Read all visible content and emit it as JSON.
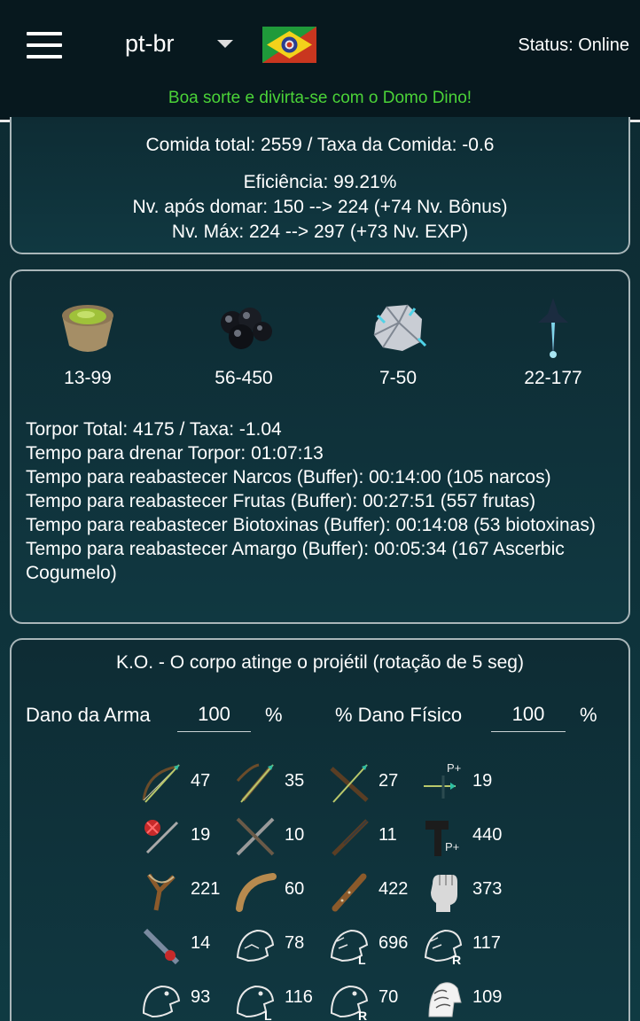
{
  "header": {
    "language": "pt-br",
    "status": "Status: Online",
    "tagline": "Boa sorte e divirta-se com o Domo Dino!"
  },
  "summary": {
    "food_line": "Comida total: 2559 / Taxa da Comida: -0.6",
    "efficiency": "Eficiência: 99.21%",
    "level_after": "Nv. após domar: 150 --> 224 (+74 Nv. Bônus)",
    "level_max": "Nv. Máx: 224 --> 297 (+73 Nv. EXP)"
  },
  "torpor": {
    "items": [
      {
        "icon": "narcotic-bowl-icon",
        "range": "13-99"
      },
      {
        "icon": "narcoberry-icon",
        "range": "56-450"
      },
      {
        "icon": "bio-toxin-icon",
        "range": "7-50"
      },
      {
        "icon": "ascerbic-mushroom-icon",
        "range": "22-177"
      }
    ],
    "lines": [
      "Torpor Total: 4175 / Taxa: -1.04",
      "Tempo para drenar Torpor: 01:07:13",
      "Tempo para reabastecer Narcos (Buffer): 00:14:00 (105 narcos)",
      "Tempo para reabastecer Frutas (Buffer): 00:27:51 (557 frutas)",
      "Tempo para reabastecer Biotoxinas (Buffer): 00:14:08 (53 biotoxinas)",
      "Tempo para reabastecer Amargo (Buffer): 00:05:34 (167 Ascerbic Cogumelo)"
    ]
  },
  "ko": {
    "title": "K.O. - O corpo atinge o projétil (rotação de 5 seg)",
    "weapon_damage_label": "Dano da Arma",
    "weapon_damage_value": "100",
    "weapon_damage_unit": "%",
    "physical_damage_label": "% Dano Físico",
    "physical_damage_value": "100",
    "physical_damage_unit": "%",
    "weapons": [
      {
        "icon": "tranq-arrow-bow-icon",
        "value": "47"
      },
      {
        "icon": "tranq-arrow-crossbow-icon",
        "value": "35"
      },
      {
        "icon": "tranq-arrow-compound-bow-icon",
        "value": "27"
      },
      {
        "icon": "tranq-arrow-plus-icon",
        "value": "19"
      },
      {
        "icon": "tranq-dart-icon",
        "value": "19"
      },
      {
        "icon": "shocking-dart-icon",
        "value": "10"
      },
      {
        "icon": "longneck-rifle-icon",
        "value": "11"
      },
      {
        "icon": "shocking-dart-plus-icon",
        "value": "440"
      },
      {
        "icon": "slingshot-icon",
        "value": "221"
      },
      {
        "icon": "boomerang-icon",
        "value": "60"
      },
      {
        "icon": "wooden-club-icon",
        "value": "422"
      },
      {
        "icon": "fist-icon",
        "value": "373"
      },
      {
        "icon": "electric-prod-icon",
        "value": "14"
      },
      {
        "icon": "dino-head-icon",
        "value": "78"
      },
      {
        "icon": "dino-head-l-icon",
        "value": "696"
      },
      {
        "icon": "dino-head-r-icon",
        "value": "117"
      },
      {
        "icon": "dino-head-2-icon",
        "value": "93"
      },
      {
        "icon": "dino-head-l2-icon",
        "value": "116"
      },
      {
        "icon": "dino-head-r2-icon",
        "value": "70"
      },
      {
        "icon": "horse-head-icon",
        "value": "109"
      }
    ]
  }
}
